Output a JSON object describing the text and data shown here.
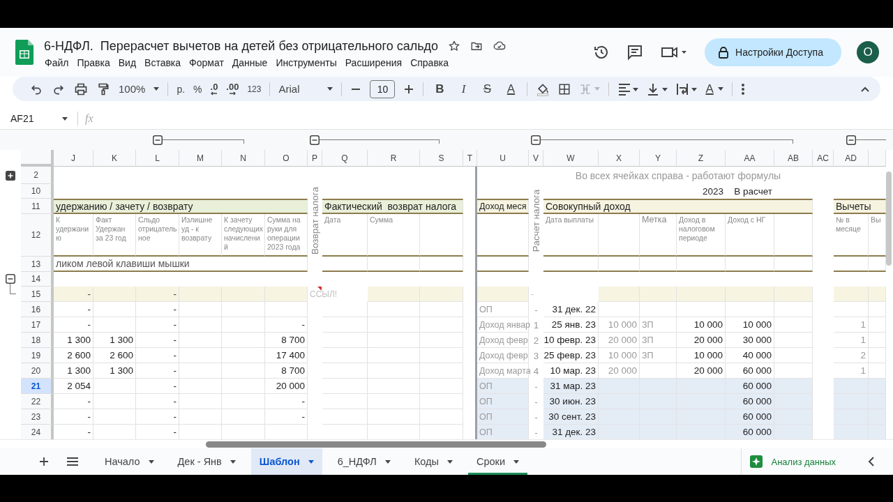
{
  "app": {
    "title": "6-НДФЛ.  Перерасчет вычетов на детей без отрицательного сальдо",
    "menu": [
      "Файл",
      "Правка",
      "Вид",
      "Вставка",
      "Формат",
      "Данные",
      "Инструменты",
      "Расширения",
      "Справка"
    ],
    "share_button": "Настройки Доступа",
    "avatar": "О"
  },
  "toolbar": {
    "zoom": "100%",
    "currency": "р.",
    "percent": "%",
    "decrease_decimals": ".0",
    "increase_decimals": ".00",
    "number_format": "123",
    "font": "Arial",
    "font_size": "10",
    "bold": "B",
    "italic": "I",
    "strikethrough": "S",
    "text_color": "A",
    "text_rotation": "A",
    "merge_cells": {
      "disabled": true
    }
  },
  "formula_bar": {
    "cell_ref": "AF21",
    "fx": "fx"
  },
  "sheet": {
    "columns": [
      {
        "label": "J",
        "kind": "number"
      },
      {
        "label": "K",
        "kind": "number"
      },
      {
        "label": "L",
        "kind": "number"
      },
      {
        "label": "M",
        "kind": "number"
      },
      {
        "label": "N",
        "kind": "number"
      },
      {
        "label": "O",
        "kind": "number"
      },
      {
        "label": "P",
        "kind": "spacer"
      },
      {
        "label": "Q",
        "kind": "number"
      },
      {
        "label": "R",
        "kind": "number"
      },
      {
        "label": "S",
        "kind": "number"
      },
      {
        "label": "T",
        "kind": "spacer"
      },
      {
        "label": "U",
        "kind": "label"
      },
      {
        "label": "V",
        "kind": "spacer"
      },
      {
        "label": "W",
        "kind": "number"
      },
      {
        "label": "X",
        "kind": "faint"
      },
      {
        "label": "Y",
        "kind": "label"
      },
      {
        "label": "Z",
        "kind": "number"
      },
      {
        "label": "AA",
        "kind": "number"
      },
      {
        "label": "AB",
        "kind": "number"
      },
      {
        "label": "AC",
        "kind": "spacer"
      },
      {
        "label": "AD",
        "kind": "faint"
      },
      {
        "kind": "faint"
      }
    ],
    "vertical_labels": [
      {
        "text": "Возврат налога"
      },
      {
        "text": "Расчет налога"
      }
    ],
    "rows": [
      {
        "number": "2",
        "kind": "caption",
        "selected": false,
        "cells": [
          null,
          null,
          null,
          null,
          null,
          null,
          null,
          null,
          null,
          null,
          null,
          null,
          null,
          "Во всех ячейках справа - работают формулы"
        ]
      },
      {
        "number": "10",
        "kind": "plain",
        "selected": false,
        "cells": [
          null,
          null,
          null,
          null,
          null,
          null,
          null,
          null,
          null,
          null,
          null,
          null,
          null,
          null,
          null,
          null,
          "2023",
          "В расчет"
        ]
      },
      {
        "number": "11",
        "kind": "band",
        "selected": false,
        "cells": [
          "удержанию / зачету / возврату",
          null,
          null,
          null,
          null,
          null,
          null,
          "Фактический  возврат налога",
          null,
          null,
          null,
          "Доход меся",
          null,
          "Совокупный доход",
          null,
          null,
          null,
          null,
          null,
          null,
          "Вычеты"
        ]
      },
      {
        "number": "12",
        "kind": "subheader",
        "selected": false,
        "cells": [
          "К удержанию",
          "Факт Удержан за 23 год",
          "Сльдо отрицательное",
          "Излишне уд - к возврату",
          "К зачету следующих начислений",
          "Сумма на руки для операции 2023 года",
          null,
          "Дата",
          "Сумма",
          null,
          null,
          null,
          null,
          "Дата выплаты",
          null,
          "Метка",
          "Доход в налоговом периоде",
          "Доход с НГ",
          null,
          null,
          "№ в месяце",
          "Вы"
        ]
      },
      {
        "number": "13",
        "kind": "note",
        "selected": false,
        "cells": [
          "ликом левой клавиши мышки"
        ]
      },
      {
        "number": "14",
        "kind": "plain",
        "selected": false
      },
      {
        "number": "15",
        "kind": "band-light",
        "selected": false,
        "cells": [
          "-",
          null,
          "-",
          null,
          null,
          null,
          {
            "text": "ССЫЛ!",
            "error": true
          },
          null,
          null,
          null,
          null,
          null,
          "-"
        ]
      },
      {
        "number": "16",
        "kind": "data",
        "selected": false,
        "cells": [
          "-",
          null,
          "-",
          null,
          null,
          null,
          null,
          null,
          null,
          null,
          null,
          "ОП",
          "-",
          "31 дек. 22"
        ]
      },
      {
        "number": "17",
        "kind": "data",
        "selected": false,
        "cells": [
          "-",
          null,
          "-",
          null,
          null,
          "-",
          null,
          null,
          null,
          null,
          null,
          "Доход январ",
          "1",
          "25 янв. 23",
          "10 000",
          "ЗП",
          "10 000",
          "10 000",
          null,
          null,
          "1"
        ]
      },
      {
        "number": "18",
        "kind": "data",
        "selected": false,
        "cells": [
          "1 300",
          "1 300",
          "-",
          null,
          null,
          "8 700",
          null,
          null,
          null,
          null,
          null,
          "Доход февр",
          "2",
          "10 февр. 23",
          "20 000",
          "ЗП",
          "20 000",
          "30 000",
          null,
          null,
          "1"
        ]
      },
      {
        "number": "19",
        "kind": "data",
        "selected": false,
        "cells": [
          "2 600",
          "2 600",
          "-",
          null,
          null,
          "17 400",
          null,
          null,
          null,
          null,
          null,
          "Доход февр",
          "3",
          "25 февр. 23",
          "10 000",
          "ЗП",
          "10 000",
          "40 000",
          null,
          null,
          "2"
        ]
      },
      {
        "number": "20",
        "kind": "data",
        "selected": false,
        "cells": [
          "1 300",
          "1 300",
          "-",
          null,
          null,
          "8 700",
          null,
          null,
          null,
          null,
          null,
          "Доход марта",
          "4",
          "10 мар. 23",
          "20 000",
          null,
          "20 000",
          "60 000",
          null,
          null,
          "1"
        ]
      },
      {
        "number": "21",
        "kind": "summary",
        "selected": true,
        "cells": [
          "2 054",
          null,
          "-",
          null,
          null,
          "20 000",
          null,
          null,
          null,
          null,
          null,
          "ОП",
          "-",
          "31 мар. 23",
          null,
          null,
          null,
          "60 000"
        ]
      },
      {
        "number": "22",
        "kind": "summary",
        "selected": false,
        "cells": [
          "-",
          null,
          "-",
          null,
          null,
          "-",
          null,
          null,
          null,
          null,
          null,
          "ОП",
          "-",
          "30 июн. 23",
          null,
          null,
          null,
          "60 000"
        ]
      },
      {
        "number": "23",
        "kind": "summary",
        "selected": false,
        "cells": [
          "-",
          null,
          "-",
          null,
          null,
          "-",
          null,
          null,
          null,
          null,
          null,
          "ОП",
          "-",
          "30 сент. 23",
          null,
          null,
          null,
          "60 000"
        ]
      },
      {
        "number": "24",
        "kind": "summary",
        "selected": false,
        "cells": [
          "-",
          null,
          "-",
          null,
          null,
          null,
          null,
          null,
          null,
          null,
          null,
          "ОП",
          "-",
          "31 дек. 23",
          null,
          null,
          null,
          "60 000"
        ]
      }
    ]
  },
  "sheet_tabs": [
    {
      "label": "Начало",
      "selected": false
    },
    {
      "label": "Дек - Янв",
      "selected": false
    },
    {
      "label": "Шаблон",
      "selected": true
    },
    {
      "label": "6_НДФЛ",
      "selected": false
    },
    {
      "label": "Коды",
      "selected": false
    },
    {
      "label": "Сроки",
      "selected": false,
      "color": "#1e8e5a"
    }
  ],
  "explore_button": "Анализ данных"
}
